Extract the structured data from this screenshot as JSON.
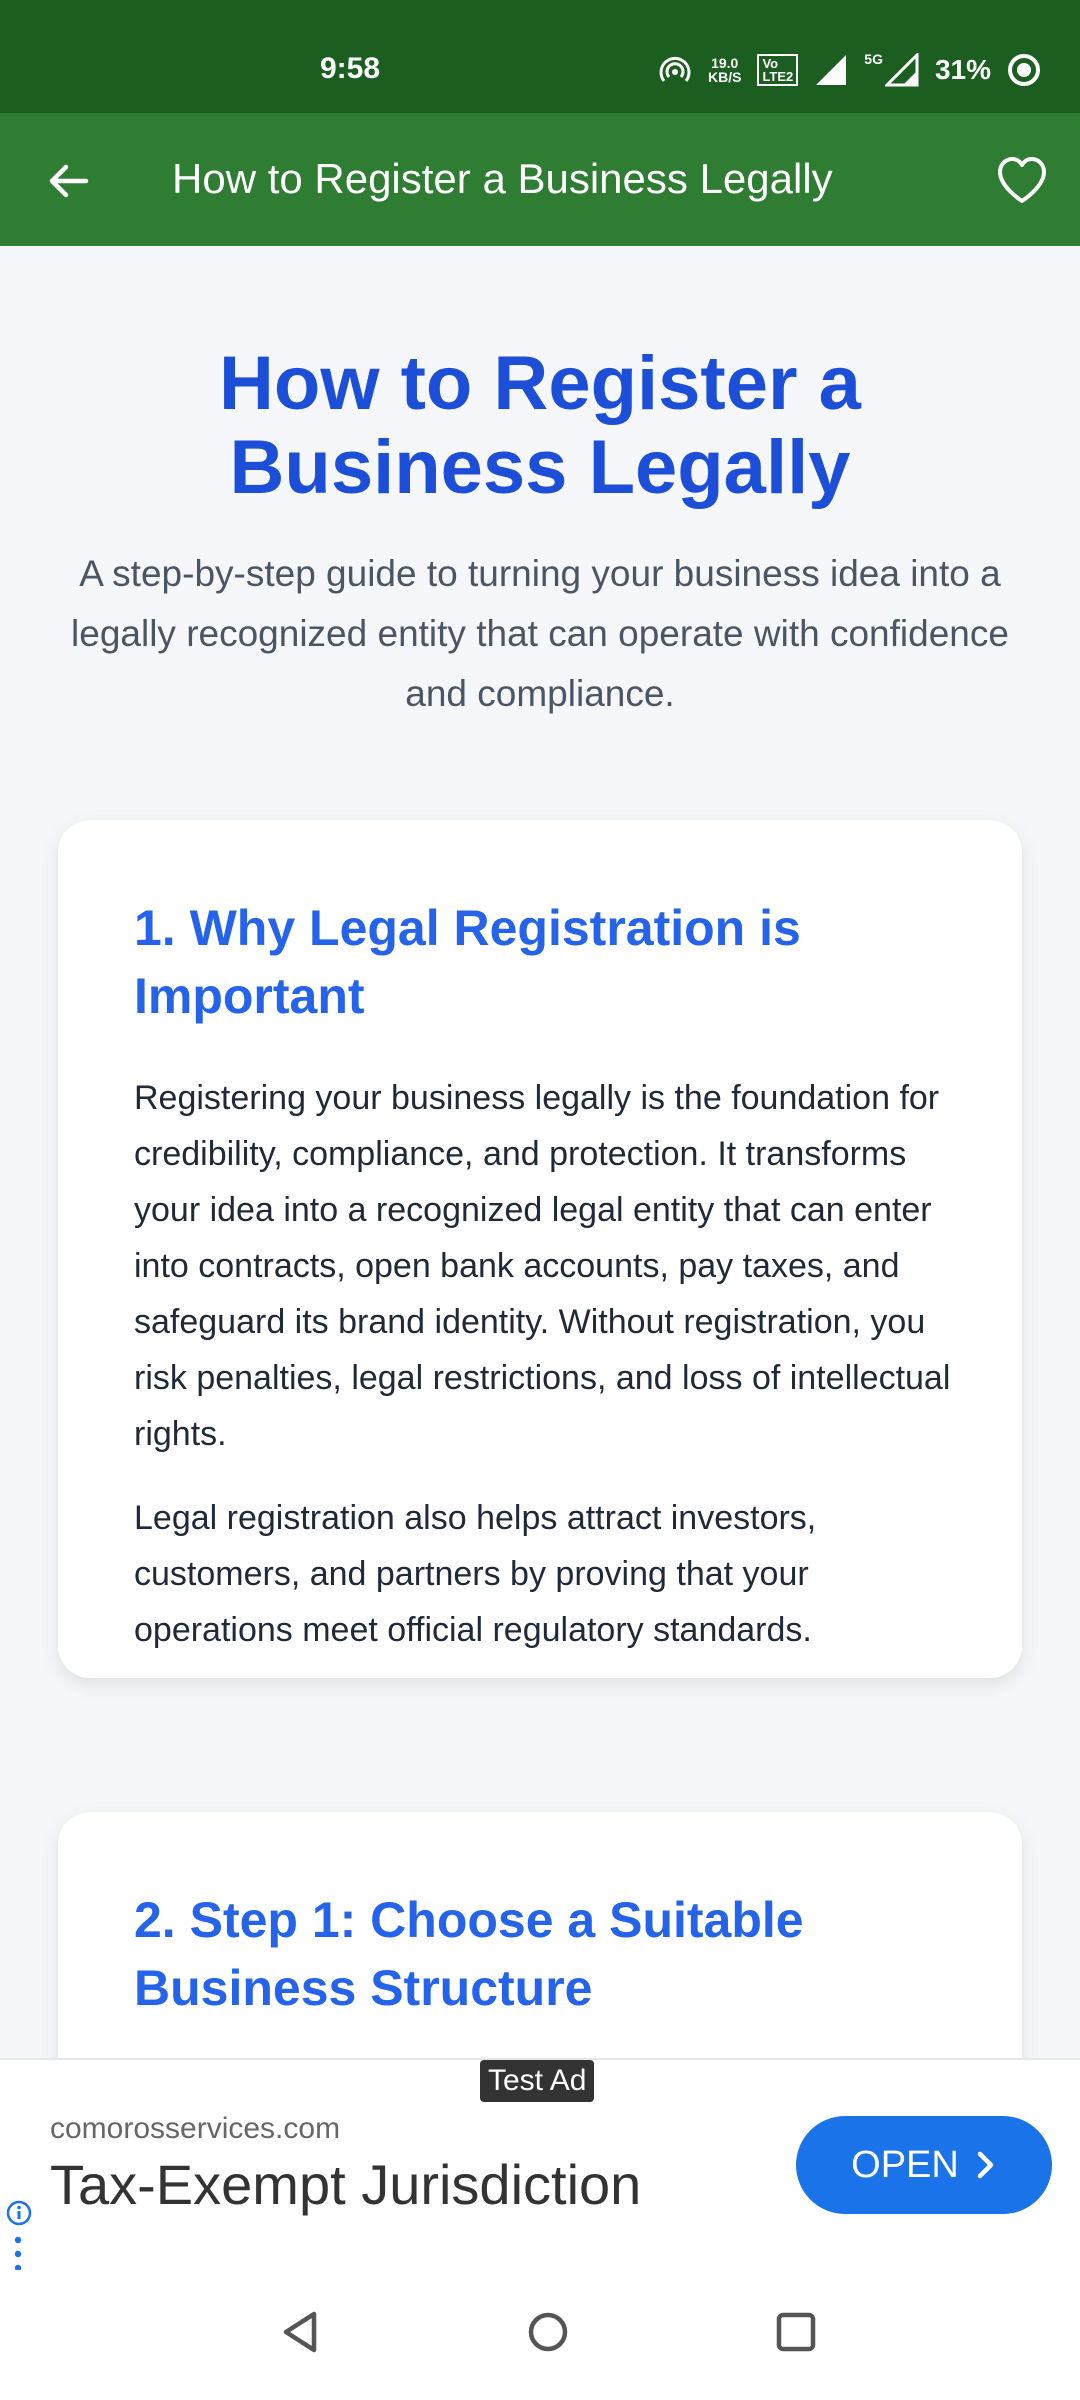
{
  "status_bar": {
    "time": "9:58",
    "net_speed_value": "19.0",
    "net_speed_unit": "KB/S",
    "volte_top": "Vo",
    "volte_bottom": "LTE2",
    "network": "5G",
    "battery": "31%"
  },
  "app_bar": {
    "title": "How to Register a Business Legally"
  },
  "hero": {
    "title": "How to Register a Business Legally",
    "subtitle": "A step-by-step guide to turning your business idea into a legally recognized entity that can operate with confidence and compliance."
  },
  "sections": [
    {
      "heading": "1. Why Legal Registration is Important",
      "paragraphs": [
        "Registering your business legally is the foundation for credibility, compliance, and protection. It transforms your idea into a recognized legal entity that can enter into contracts, open bank accounts, pay taxes, and safeguard its brand identity. Without registration, you risk penalties, legal restrictions, and loss of intellectual rights.",
        "Legal registration also helps attract investors, customers, and partners by proving that your operations meet official regulatory standards."
      ]
    },
    {
      "heading": "2. Step 1: Choose a Suitable Business Structure"
    }
  ],
  "ad": {
    "label": "Test Ad",
    "domain": "comorosservices.com",
    "headline": "Tax-Exempt Jurisdiction",
    "button": "OPEN"
  },
  "colors": {
    "status_bar": "#1b5e20",
    "app_bar": "#2e7d32",
    "hero_title": "#1d4ed8",
    "section_heading": "#2563eb",
    "ad_button": "#1a73e8"
  },
  "icons": {
    "back": "arrow-left-icon",
    "favorite": "heart-outline-icon",
    "ad_info": "info-icon",
    "nav_back": "triangle-back-icon",
    "nav_home": "circle-home-icon",
    "nav_recents": "square-recents-icon"
  }
}
